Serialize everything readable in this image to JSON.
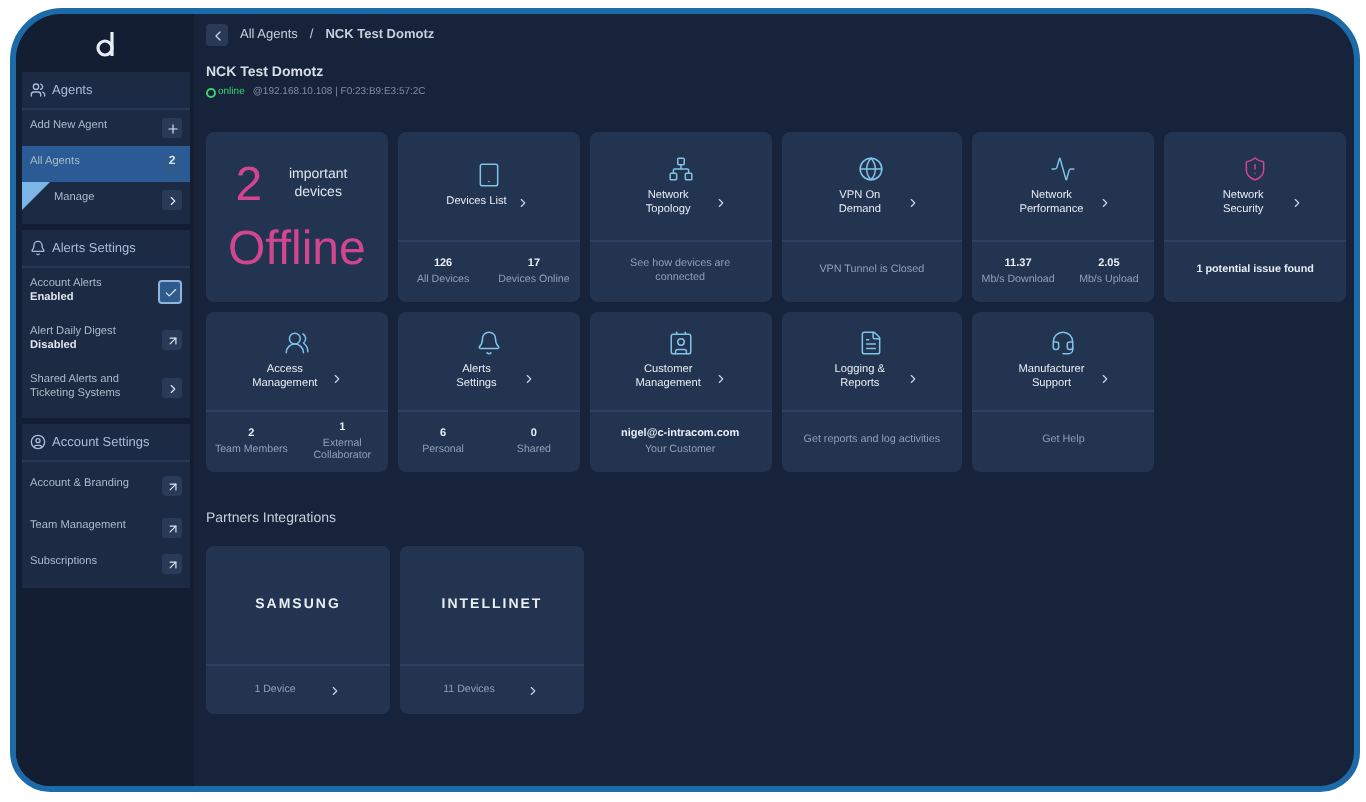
{
  "sidebar": {
    "sections": [
      {
        "title": "Agents",
        "items": [
          {
            "label": "Add New Agent",
            "kind": "add",
            "selected": false
          },
          {
            "label": "All Agents",
            "kind": "count",
            "count": "2",
            "selected": true
          },
          {
            "label": "Manage",
            "kind": "link",
            "selected": false
          }
        ]
      },
      {
        "title": "Alerts Settings",
        "items": [
          {
            "label": "Account Alerts",
            "sub": "Enabled",
            "kind": "check",
            "checked": true,
            "selected": false
          },
          {
            "label": "Alert Daily Digest",
            "sub": "Disabled",
            "kind": "external",
            "selected": false
          },
          {
            "label": "Shared Alerts and Ticketing Systems",
            "kind": "link",
            "selected": false
          }
        ]
      },
      {
        "title": "Account Settings",
        "items": [
          {
            "label": "Account & Branding",
            "kind": "external",
            "selected": false
          },
          {
            "label": "Team Management",
            "kind": "external",
            "selected": false
          },
          {
            "label": "Subscriptions",
            "kind": "external",
            "selected": false
          }
        ]
      }
    ]
  },
  "breadcrumb": [
    "All Agents",
    "NCK Test Domotz"
  ],
  "breadcrumb_separator": "/",
  "agent": {
    "name": "NCK Test Domotz",
    "status": "online",
    "details": "@192.168.10.108 | F0:23:B9:E3:57:2C"
  },
  "cards": [
    {
      "kind": "alert",
      "count": "2",
      "label": "important devices",
      "status": "Offline"
    },
    {
      "kind": "stats",
      "title": "Devices List",
      "stats": [
        {
          "value": "126",
          "label": "All Devices"
        },
        {
          "value": "17",
          "label": "Devices Online"
        }
      ]
    },
    {
      "kind": "text",
      "title": "Network Topology",
      "text": "See how devices are connected",
      "strong": false
    },
    {
      "kind": "text",
      "title": "VPN On Demand",
      "text": "VPN Tunnel is Closed",
      "strong": false
    },
    {
      "kind": "stats",
      "title": "Network Performance",
      "stats": [
        {
          "value": "11.37",
          "label": "Mb/s Download"
        },
        {
          "value": "2.05",
          "label": "Mb/s Upload"
        }
      ]
    },
    {
      "kind": "text",
      "title": "Network Security",
      "text": "1 potential issue found",
      "strong": true
    },
    {
      "kind": "stats",
      "title": "Access Management",
      "stats": [
        {
          "value": "2",
          "label": "Team Members"
        },
        {
          "value": "1",
          "label": "External Collaborator"
        }
      ]
    },
    {
      "kind": "stats",
      "title": "Alerts Settings",
      "stats": [
        {
          "value": "6",
          "label": "Personal"
        },
        {
          "value": "0",
          "label": "Shared"
        }
      ]
    },
    {
      "kind": "stats",
      "title": "Customer Management",
      "stats": [
        {
          "value": "nigel@c-intracom.com",
          "label": "Your Customer"
        }
      ]
    },
    {
      "kind": "text",
      "title": "Logging & Reports",
      "text": "Get reports and log activities",
      "strong": false
    },
    {
      "kind": "text",
      "title": "Manufacturer Support",
      "text": "Get Help",
      "strong": false
    }
  ],
  "partners": {
    "title": "Partners Integrations",
    "items": [
      {
        "logo": "SAMSUNG",
        "footer": "1 Device"
      },
      {
        "logo": "INTELLINET",
        "footer": "11 Devices"
      }
    ]
  }
}
